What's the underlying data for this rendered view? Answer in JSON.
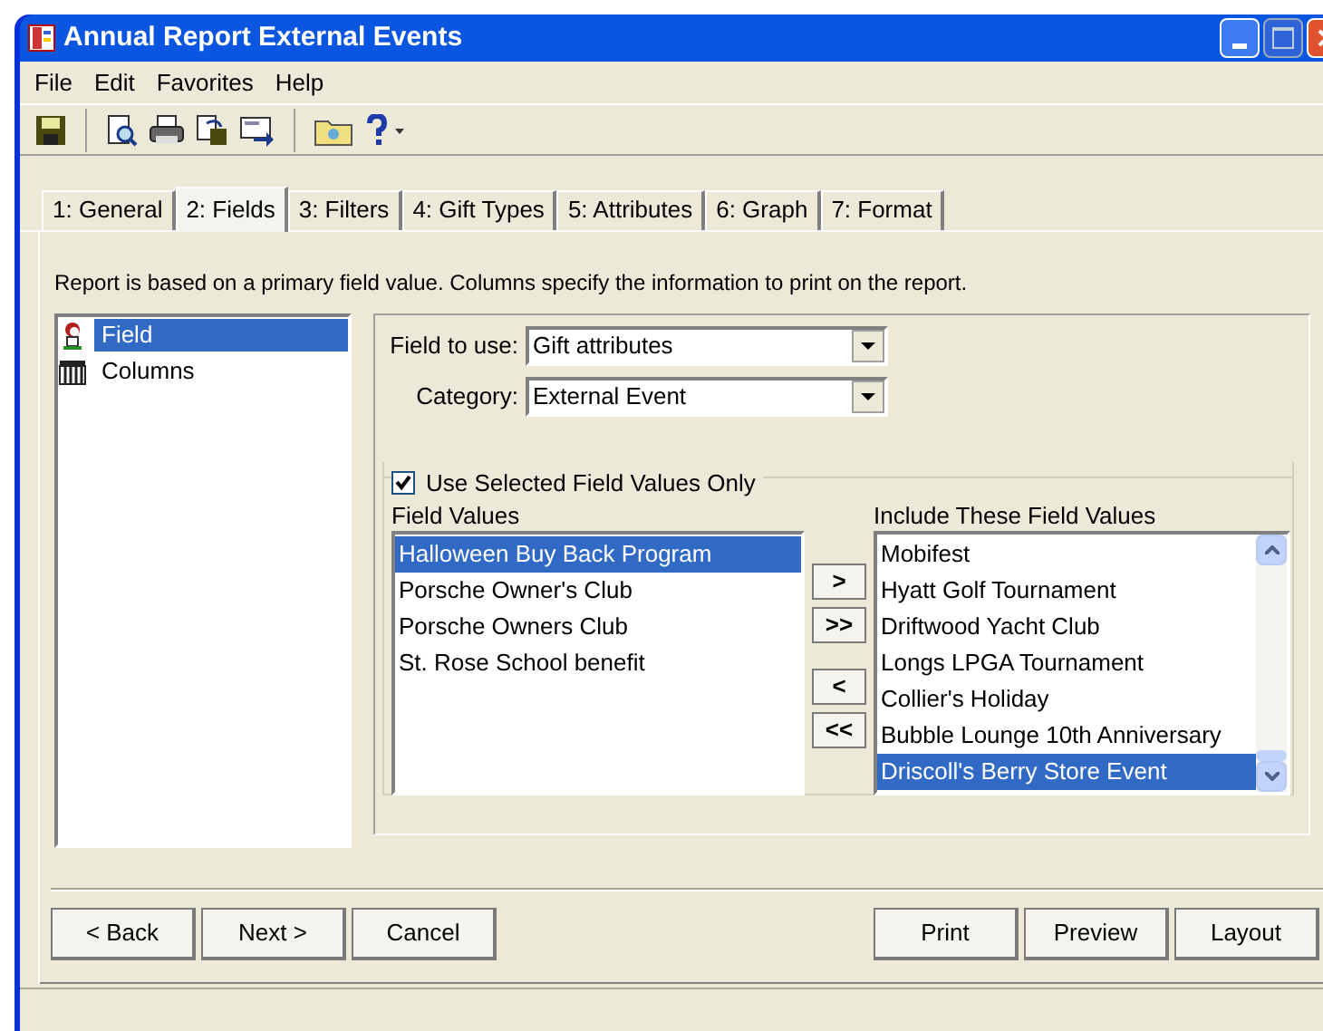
{
  "window": {
    "title": "Annual Report External Events"
  },
  "menu": [
    "File",
    "Edit",
    "Favorites",
    "Help"
  ],
  "toolbar": [
    {
      "kind": "save"
    },
    {
      "kind": "sep"
    },
    {
      "kind": "preview"
    },
    {
      "kind": "print"
    },
    {
      "kind": "copy"
    },
    {
      "kind": "send"
    },
    {
      "kind": "sep"
    },
    {
      "kind": "folder"
    },
    {
      "kind": "help"
    }
  ],
  "tabs": [
    {
      "label": "1: General",
      "selected": false
    },
    {
      "label": "2: Fields",
      "selected": true
    },
    {
      "label": "3: Filters",
      "selected": false
    },
    {
      "label": "4: Gift Types",
      "selected": false
    },
    {
      "label": "5: Attributes",
      "selected": false
    },
    {
      "label": "6: Graph",
      "selected": false
    },
    {
      "label": "7: Format",
      "selected": false
    }
  ],
  "description": "Report is based on a primary field value.  Columns specify the information to print on the report.",
  "tree": [
    {
      "label": "Field",
      "kind": "person",
      "selected": true
    },
    {
      "label": "Columns",
      "kind": "columns",
      "selected": false
    }
  ],
  "field_to_use": {
    "label": "Field to use:",
    "value": "Gift attributes"
  },
  "category": {
    "label": "Category:",
    "value": "External Event"
  },
  "use_selected": {
    "label": "Use Selected Field Values Only",
    "checked": true
  },
  "field_values": {
    "label": "Field Values",
    "items": [
      {
        "text": "Halloween Buy Back Program",
        "selected": true
      },
      {
        "text": "Porsche Owner's Club",
        "selected": false
      },
      {
        "text": "Porsche Owners Club",
        "selected": false
      },
      {
        "text": "St. Rose School benefit",
        "selected": false
      }
    ]
  },
  "move_buttons": [
    ">",
    ">>",
    "<",
    "<<"
  ],
  "include_values": {
    "label": "Include These Field Values",
    "items": [
      {
        "text": "Mobifest",
        "selected": false
      },
      {
        "text": "Hyatt Golf Tournament",
        "selected": false
      },
      {
        "text": "Driftwood Yacht Club",
        "selected": false
      },
      {
        "text": "Longs LPGA Tournament",
        "selected": false
      },
      {
        "text": "Collier's Holiday",
        "selected": false
      },
      {
        "text": "Bubble Lounge 10th Anniversary",
        "selected": false
      },
      {
        "text": "Driscoll's Berry Store Event",
        "selected": true
      }
    ]
  },
  "left_buttons": [
    "< Back",
    "Next >",
    "Cancel"
  ],
  "right_buttons": [
    "Print",
    "Preview",
    "Layout"
  ]
}
